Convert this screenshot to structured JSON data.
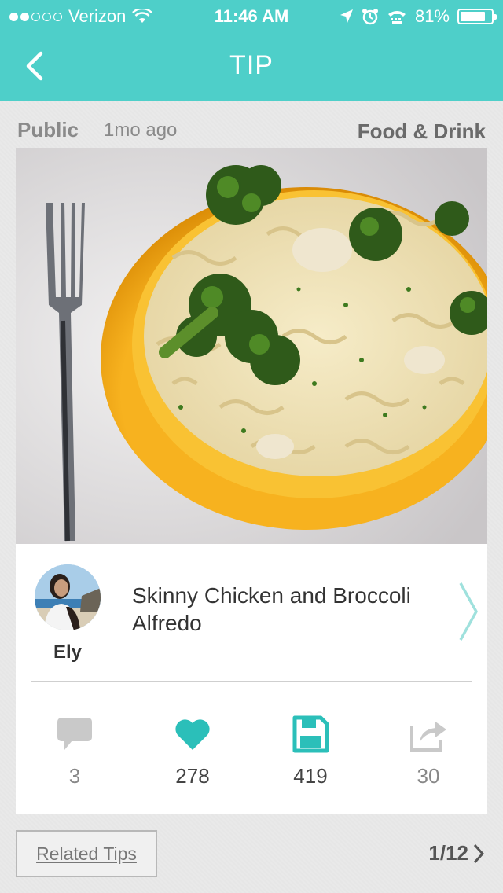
{
  "status_bar": {
    "carrier": "Verizon",
    "time": "11:46 AM",
    "battery": "81%",
    "battery_level": 0.81,
    "signal_bars_filled": 2,
    "signal_bars_total": 5
  },
  "nav": {
    "title": "TIP",
    "back_icon": "chevron-left-icon"
  },
  "meta": {
    "visibility": "Public",
    "posted": "1mo ago",
    "category": "Food & Drink"
  },
  "photo": {
    "subject": "bowl of rotini pasta with broccoli and chicken in alfredo sauce"
  },
  "tip": {
    "title": "Skinny Chicken and Broccoli Alfredo",
    "author": "Ely"
  },
  "stats": {
    "comments": "3",
    "likes": "278",
    "saves": "419",
    "shares": "30"
  },
  "footer": {
    "related_label": "Related Tips",
    "pager": "1/12"
  },
  "colors": {
    "accent": "#4ecfc9",
    "heart": "#2bbfb9"
  }
}
